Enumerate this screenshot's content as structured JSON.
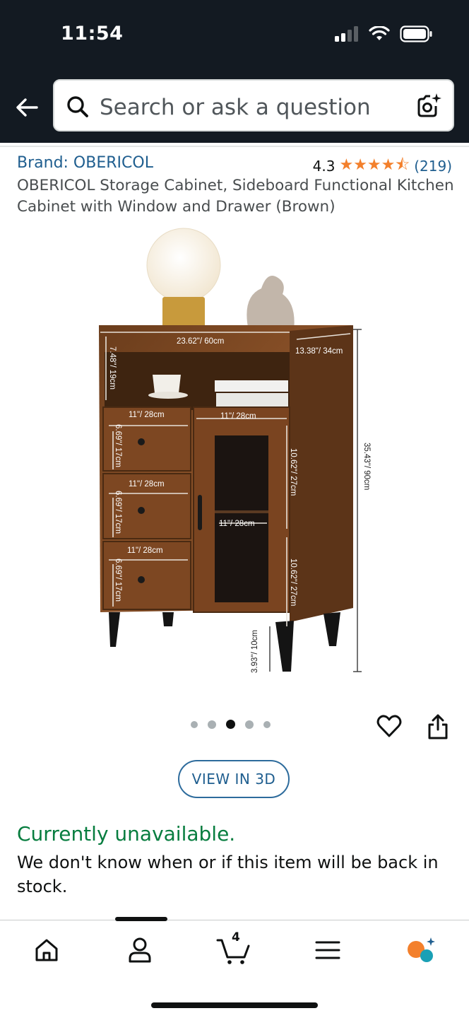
{
  "status_bar": {
    "time": "11:54"
  },
  "search": {
    "placeholder": "Search or ask a question"
  },
  "product": {
    "brand": "Brand: OBERICOL",
    "rating_value": "4.3",
    "stars": "★★★★⯪",
    "rating_count": "(219)",
    "title": "OBERICOL Storage Cabinet, Sideboard Functional Kitchen Cabinet with Window and Drawer (Brown)",
    "image_dimensions": {
      "width": "23.62\"/ 60cm",
      "depth": "13.38\"/ 34cm",
      "top_shelf": "7.48\"/ 19cm",
      "height": "35.43\"/ 90cm",
      "drawer_width_1": "11\"/ 28cm",
      "drawer_width_2": "11\"/ 28cm",
      "drawer_width_3": "11\"/ 28cm",
      "door_width": "11\"/ 28cm",
      "shelf_width": "11\"/ 28cm",
      "drawer_height_1": "6.69\"/ 17cm",
      "drawer_height_2": "6.69\"/ 17cm",
      "drawer_height_3": "6.69\"/ 17cm",
      "door_upper": "10.62\"/ 27cm",
      "door_lower": "10.62\"/ 27cm",
      "leg": "3.93\"/ 10cm"
    },
    "carousel": {
      "count": 5,
      "active_index": 2
    },
    "view_3d_label": "VIEW IN 3D",
    "availability": "Currently unavailable.",
    "stock_note": "We don't know when or if this item will be back in stock."
  },
  "bottom_nav": {
    "items": [
      "home-icon",
      "account-icon",
      "cart-icon",
      "menu-icon",
      "rufus-icon"
    ],
    "cart_count": "4"
  },
  "colors": {
    "header_bg": "#131a22",
    "link": "#1f5e8f",
    "star": "#f3802c",
    "availability": "#077d3f",
    "rufus_orange": "#f3802c",
    "rufus_teal": "#1aa0b5"
  }
}
